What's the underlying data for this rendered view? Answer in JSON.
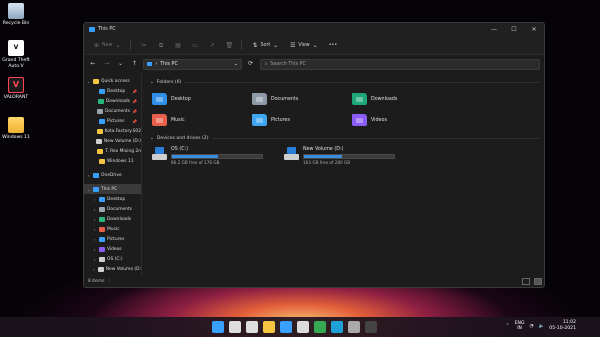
{
  "desktop": {
    "icons": [
      {
        "label": "Recycle Bin",
        "icon": "recycle-bin-icon"
      },
      {
        "label": "Grand Theft Auto V",
        "icon": "gta-v-icon"
      },
      {
        "label": "VALORANT",
        "icon": "valorant-icon"
      },
      {
        "label": "Windows 11",
        "icon": "folder-icon"
      }
    ]
  },
  "window": {
    "title": "This PC",
    "controls": {
      "minimize": "—",
      "maximize": "☐",
      "close": "✕"
    }
  },
  "commandbar": {
    "new_label": "New",
    "sort_label": "Sort",
    "view_label": "View",
    "more": "•••"
  },
  "addressbar": {
    "back": "←",
    "forward": "→",
    "recent": "⌄",
    "up": "↑",
    "path": "This PC",
    "refresh": "⟳",
    "search_placeholder": "Search This PC"
  },
  "nav": {
    "items": [
      {
        "label": "Quick access",
        "level": 0,
        "chevron": "⌄",
        "color": "#f5c542",
        "pinned": false
      },
      {
        "label": "Desktop",
        "level": 1,
        "chevron": "",
        "color": "#3aa0ff",
        "pinned": true
      },
      {
        "label": "Downloads",
        "level": 1,
        "chevron": "",
        "color": "#2ab67a",
        "pinned": true
      },
      {
        "label": "Documents",
        "level": 1,
        "chevron": "",
        "color": "#9aa5b1",
        "pinned": true
      },
      {
        "label": "Pictures",
        "level": 1,
        "chevron": "",
        "color": "#3aa0ff",
        "pinned": true
      },
      {
        "label": "Kota.Factory.S02",
        "level": 1,
        "chevron": "",
        "color": "#f5c542",
        "pinned": false
      },
      {
        "label": "New Volume (D:)",
        "level": 1,
        "chevron": "",
        "color": "#cfcfcf",
        "pinned": false
      },
      {
        "label": "T. Rex Mixing 2n",
        "level": 1,
        "chevron": "",
        "color": "#f5c542",
        "pinned": false
      },
      {
        "label": "Windows 11",
        "level": 1,
        "chevron": "",
        "color": "#f5c542",
        "pinned": false
      },
      {
        "label": "OneDrive",
        "level": 0,
        "chevron": "›",
        "color": "#3aa0ff",
        "pinned": false
      },
      {
        "label": "This PC",
        "level": 0,
        "chevron": "⌄",
        "color": "#3aa0ff",
        "pinned": false,
        "selected": true
      },
      {
        "label": "Desktop",
        "level": 1,
        "chevron": "›",
        "color": "#3aa0ff",
        "pinned": false
      },
      {
        "label": "Documents",
        "level": 1,
        "chevron": "›",
        "color": "#9aa5b1",
        "pinned": false
      },
      {
        "label": "Downloads",
        "level": 1,
        "chevron": "›",
        "color": "#2ab67a",
        "pinned": false
      },
      {
        "label": "Music",
        "level": 1,
        "chevron": "›",
        "color": "#e8604c",
        "pinned": false
      },
      {
        "label": "Pictures",
        "level": 1,
        "chevron": "›",
        "color": "#3aa0ff",
        "pinned": false
      },
      {
        "label": "Videos",
        "level": 1,
        "chevron": "›",
        "color": "#8b5cf6",
        "pinned": false
      },
      {
        "label": "OS (C:)",
        "level": 1,
        "chevron": "›",
        "color": "#cfcfcf",
        "pinned": false
      },
      {
        "label": "New Volume (D:",
        "level": 1,
        "chevron": "›",
        "color": "#cfcfcf",
        "pinned": false
      }
    ]
  },
  "content": {
    "folders_header": "Folders (6)",
    "folders": [
      {
        "label": "Desktop",
        "color": "#2f8fe6"
      },
      {
        "label": "Documents",
        "color": "#8e9aa8"
      },
      {
        "label": "Downloads",
        "color": "#1fa67a"
      },
      {
        "label": "Music",
        "color": "#e8604c"
      },
      {
        "label": "Pictures",
        "color": "#3ea6f0"
      },
      {
        "label": "Videos",
        "color": "#8b5cf6"
      }
    ],
    "drives_header": "Devices and drives (2)",
    "drives": [
      {
        "label": "OS (C:)",
        "free_text": "86.2 GB free of 176 GB",
        "used_fraction": 0.51
      },
      {
        "label": "New Volume (D:)",
        "free_text": "163 GB free of 280 GB",
        "used_fraction": 0.42
      }
    ]
  },
  "statusbar": {
    "items_text": "8 items",
    "separator": "|"
  },
  "taskbar": {
    "apps": [
      {
        "icon": "start-icon",
        "color": "#3aa0ff"
      },
      {
        "icon": "search-icon",
        "color": "#dddddd"
      },
      {
        "icon": "task-view-icon",
        "color": "#dddddd"
      },
      {
        "icon": "file-explorer-icon",
        "color": "#f5c542"
      },
      {
        "icon": "widgets-icon",
        "color": "#3aa0ff"
      },
      {
        "icon": "store-icon",
        "color": "#dddddd"
      },
      {
        "icon": "chrome-icon",
        "color": "#34a853"
      },
      {
        "icon": "edge-icon",
        "color": "#1fa0d8"
      },
      {
        "icon": "settings-icon",
        "color": "#aaaaaa"
      },
      {
        "icon": "terminal-icon",
        "color": "#444444"
      }
    ],
    "tray": {
      "lang_line1": "ENG",
      "lang_line2": "IN",
      "time": "11:02",
      "date": "05-10-2021"
    }
  }
}
